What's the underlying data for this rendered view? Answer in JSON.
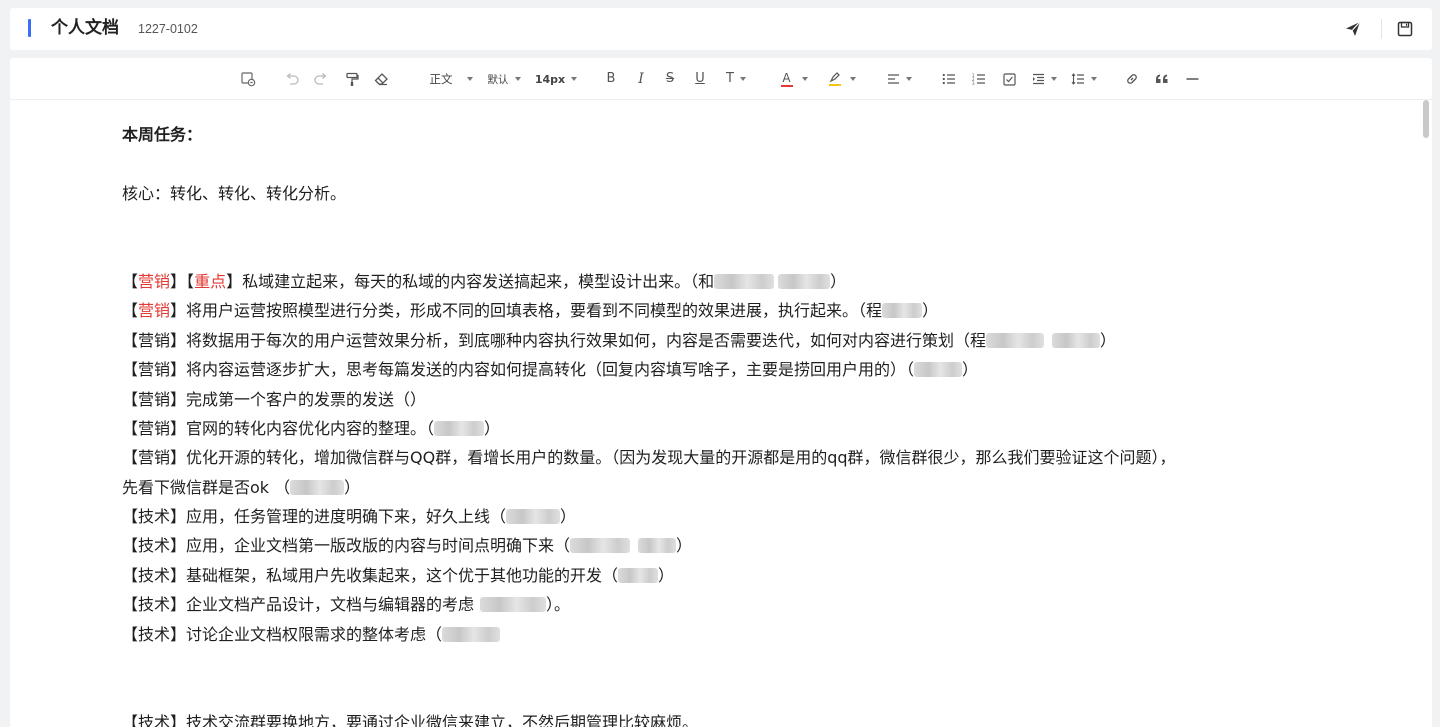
{
  "header": {
    "title": "个人文档",
    "doc_id": "1227-0102",
    "send_icon": "send-icon",
    "save_icon": "save-icon",
    "accent_color": "#3b6ef5"
  },
  "toolbar": {
    "paragraph_style": "正文",
    "font_family": "默认",
    "font_size": "14px",
    "bold_label": "B",
    "italic_label": "I",
    "strike_label": "S",
    "underline_label": "U",
    "format_label": "T",
    "font_color_label": "A",
    "font_color": "#e53935",
    "highlight_color": "#f5c518"
  },
  "content": {
    "heading": "本周任务：",
    "core": "核心：转化、转化、转化分析。",
    "tag_marketing": "【营销】",
    "tag_marketing_open": "【",
    "tag_marketing_word": "营销",
    "tag_marketing_close": "】",
    "tag_key_open": "【",
    "tag_key_word": "重点",
    "tag_key_close": "】",
    "tag_tech": "【技术】",
    "lines": {
      "l1_text": "私域建立起来，每天的私域的内容发送搞起来，模型设计出来。（和",
      "l1_end": "）",
      "l2_text": "将用户运营按照模型进行分类，形成不同的回填表格，要看到不同模型的效果进展，执行起来。（程",
      "l2_end": "）",
      "l3_text": "将数据用于每次的用户运营效果分析，到底哪种内容执行效果如何，内容是否需要迭代，如何对内容进行策划（程",
      "l3_end": "）",
      "l4_text": "将内容运营逐步扩大，思考每篇发送的内容如何提高转化（回复内容填写啥子，主要是捞回用户用的）（",
      "l4_end": "）",
      "l5_text": "完成第一个客户的发票的发送（）",
      "l6_text": "官网的转化内容优化内容的整理。（",
      "l6_end": "）",
      "l7_text": "优化开源的转化，增加微信群与QQ群，看增长用户的数量。（因为发现大量的开源都是用的qq群，微信群很少，那么我们要验证这个问题），",
      "l7b_text": "先看下微信群是否ok （",
      "l7b_end": "）",
      "l8_text": "应用，任务管理的进度明确下来，好久上线（",
      "l8_end": "）",
      "l9_text": "应用，企业文档第一版改版的内容与时间点明确下来（",
      "l9_end": "）",
      "l10_text": "基础框架，私域用户先收集起来，这个优于其他功能的开发（",
      "l10_end": "）",
      "l11_text": "企业文档产品设计，文档与编辑器的考虑",
      "l11_end": "）。",
      "l12_text": "讨论企业文档权限需求的整体考虑（",
      "l13_text": "技术交流群要换地方，要通过企业微信来建立，不然后期管理比较麻烦。"
    }
  }
}
